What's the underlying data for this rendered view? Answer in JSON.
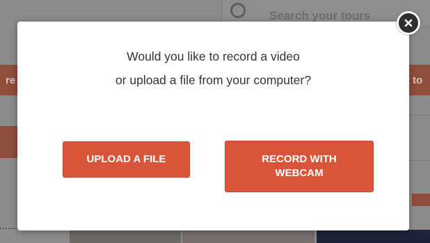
{
  "background": {
    "search_placeholder": "Search your tours",
    "band_left_text": "re",
    "band_right_text": "t to"
  },
  "modal": {
    "prompt_line1": "Would you like to record a video",
    "prompt_line2": "or upload a file from your computer?",
    "upload_label": "UPLOAD A FILE",
    "record_label_line1": "RECORD WITH",
    "record_label_line2": "WEBCAM",
    "close_icon": "close-icon"
  },
  "colors": {
    "accent": "#d9553a",
    "overlay": "#8c8c8c",
    "close_bg": "#2f2f2f"
  }
}
